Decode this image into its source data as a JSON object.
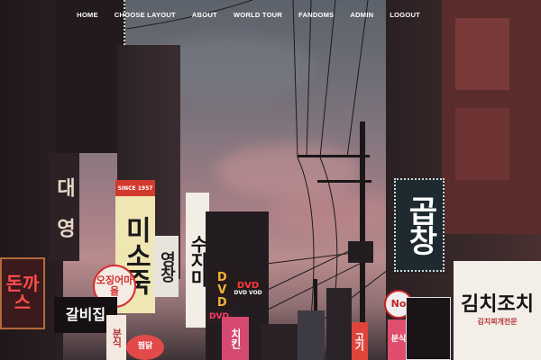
{
  "nav": {
    "items": [
      {
        "label": "HOME"
      },
      {
        "label": "CHOOSE LAYOUT"
      },
      {
        "label": "ABOUT"
      },
      {
        "label": "WORLD TOUR"
      },
      {
        "label": "FANDOMS"
      },
      {
        "label": "ADMIN"
      },
      {
        "label": "LOGOUT"
      }
    ]
  },
  "hero": {
    "signs": {
      "since_1957": "SINCE 1957",
      "misojuk": "미소죽",
      "yeongchang": "영창",
      "sujimi": "수지미",
      "dvd_left": "DVD",
      "dvd_right": "DVD",
      "dvd_vod": "DVD VOD",
      "ojinggi": "오징어마을",
      "jjimtak": "찜닭",
      "galbi": "갈비집",
      "bottom_left_pink": "돈까스",
      "hero_dae": "대 영",
      "no_sign": "No",
      "kimchi": "김치조치",
      "kimchi_sub": "김치찌개전문",
      "gopchang": "곱창",
      "red_vert": "고기",
      "chicken": "치킨",
      "pink_bot": "분식"
    }
  }
}
